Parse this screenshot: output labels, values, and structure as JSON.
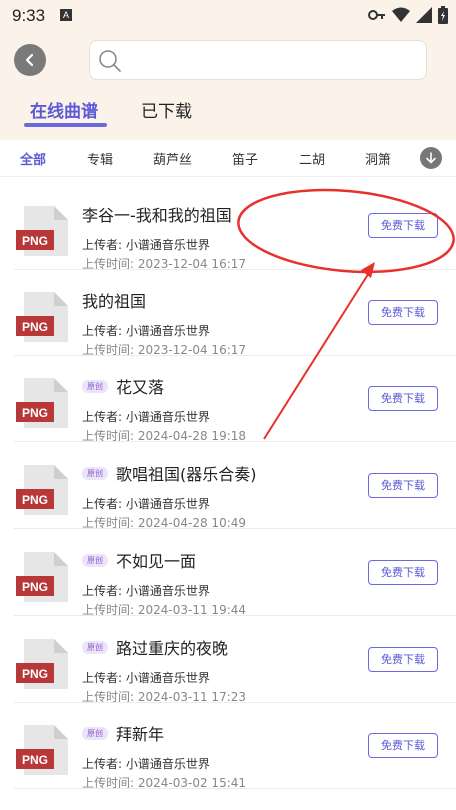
{
  "status_bar": {
    "time": "9:33",
    "a_icon": "A",
    "icons": [
      "key-icon",
      "wifi-icon",
      "signal-icon",
      "battery-icon"
    ]
  },
  "search": {
    "placeholder": ""
  },
  "tabs": [
    {
      "label": "在线曲谱"
    },
    {
      "label": "已下载"
    }
  ],
  "categories": [
    {
      "label": "全部"
    },
    {
      "label": "专辑"
    },
    {
      "label": "葫芦丝"
    },
    {
      "label": "笛子"
    },
    {
      "label": "二胡"
    },
    {
      "label": "洞箫"
    }
  ],
  "list": {
    "uploader_label": "上传者:",
    "time_label": "上传时间:",
    "badge_label": "原创",
    "download_label": "免费下载",
    "file_type": "PNG",
    "items": [
      {
        "title": "李谷一-我和我的祖国",
        "uploader": "小谱通音乐世界",
        "time": "2023-12-04 16:17",
        "original": false
      },
      {
        "title": "我的祖国",
        "uploader": "小谱通音乐世界",
        "time": "2023-12-04 16:17",
        "original": false
      },
      {
        "title": "花又落",
        "uploader": "小谱通音乐世界",
        "time": "2024-04-28 19:18",
        "original": true
      },
      {
        "title": "歌唱祖国(器乐合奏)",
        "uploader": "小谱通音乐世界",
        "time": "2024-04-28 10:49",
        "original": true
      },
      {
        "title": "不如见一面",
        "uploader": "小谱通音乐世界",
        "time": "2024-03-11 19:44",
        "original": true
      },
      {
        "title": "路过重庆的夜晚",
        "uploader": "小谱通音乐世界",
        "time": "2024-03-11 17:23",
        "original": true
      },
      {
        "title": "拜新年",
        "uploader": "小谱通音乐世界",
        "time": "2024-03-02 15:41",
        "original": true
      }
    ]
  },
  "colors": {
    "accent": "#5a5ad6",
    "header_bg": "#fbf3ea",
    "annotation_red": "#e8312a",
    "png_red": "#b8383a"
  }
}
